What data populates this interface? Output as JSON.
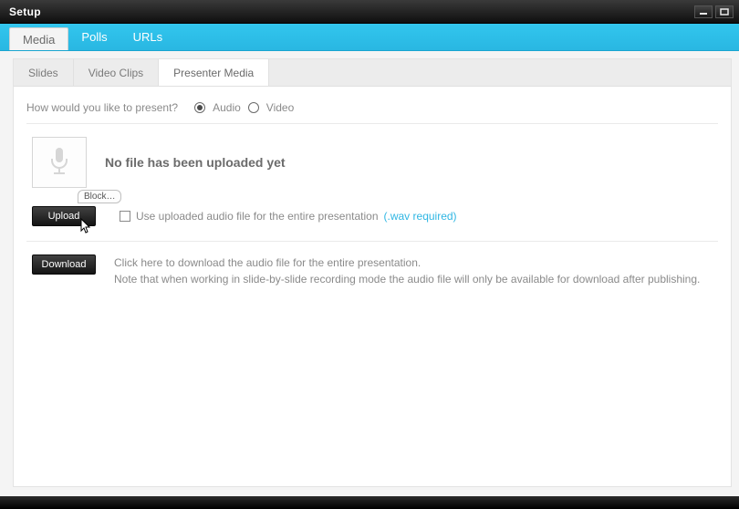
{
  "window": {
    "title": "Setup"
  },
  "topnav": {
    "tabs": [
      {
        "label": "Media",
        "active": true
      },
      {
        "label": "Polls",
        "active": false
      },
      {
        "label": "URLs",
        "active": false
      }
    ]
  },
  "subtabs": {
    "tabs": [
      {
        "label": "Slides",
        "active": false
      },
      {
        "label": "Video Clips",
        "active": false
      },
      {
        "label": "Presenter Media",
        "active": true
      }
    ]
  },
  "prompt": {
    "question": "How would you like to present?",
    "options": {
      "audio": "Audio",
      "video": "Video",
      "selected": "audio"
    }
  },
  "upload_area": {
    "no_file_text": "No file has been uploaded yet",
    "tooltip": "Block…",
    "upload_button": "Upload",
    "checkbox_label": "Use uploaded audio file for the entire presentation",
    "wav_note": "(.wav required)"
  },
  "download_area": {
    "button": "Download",
    "line1": "Click here to download the audio file for the entire presentation.",
    "line2": "Note that when working in slide-by-slide recording mode the audio file will only be available for download after publishing."
  },
  "icons": {
    "mic": "mic-icon",
    "minimize": "minimize-icon",
    "maximize": "maximize-icon"
  }
}
